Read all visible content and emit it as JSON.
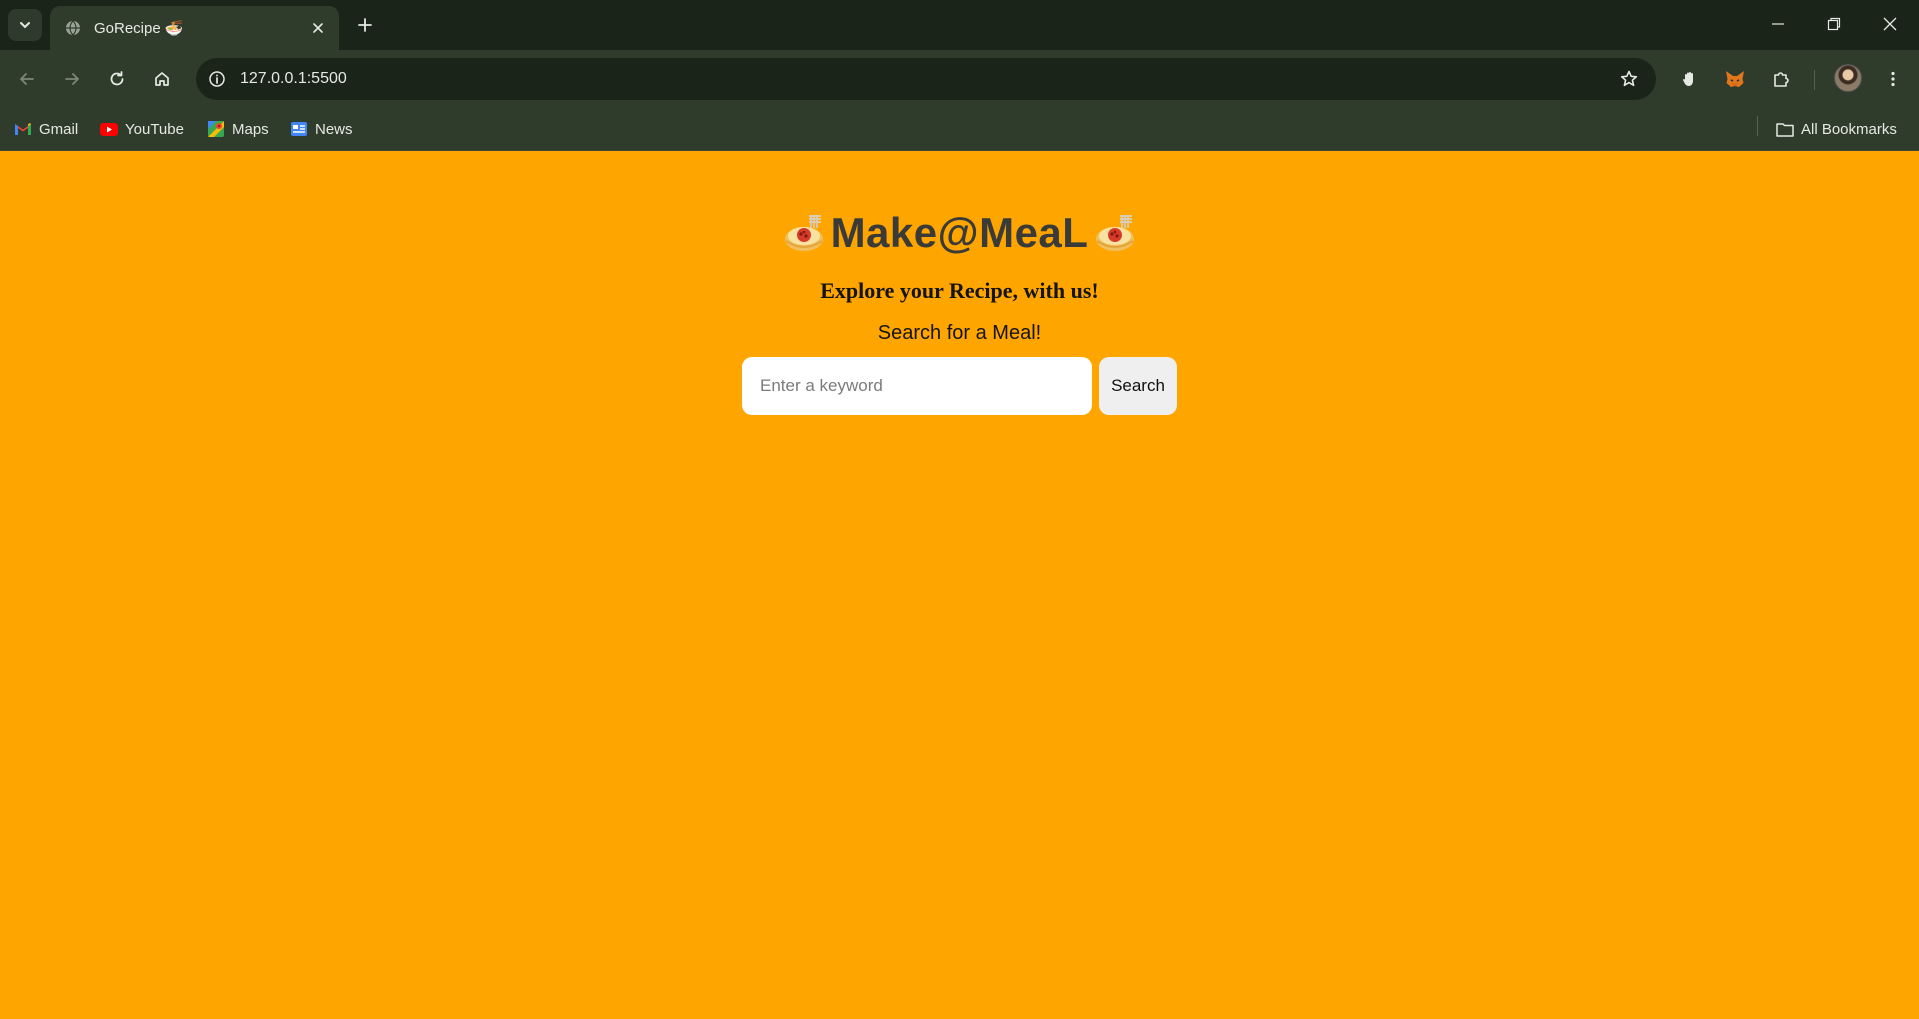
{
  "browser": {
    "tab": {
      "title": "GoRecipe 🍜"
    },
    "address_bar": {
      "url": "127.0.0.1:5500"
    },
    "bookmarks": [
      {
        "label": "Gmail",
        "icon": "gmail-icon"
      },
      {
        "label": "YouTube",
        "icon": "youtube-icon"
      },
      {
        "label": "Maps",
        "icon": "maps-icon"
      },
      {
        "label": "News",
        "icon": "news-icon"
      }
    ],
    "all_bookmarks_label": "All Bookmarks"
  },
  "page": {
    "title": "Make@MeaL",
    "title_icon": "spaghetti-icon",
    "tagline": "Explore your Recipe, with us!",
    "search_label": "Search for a Meal!",
    "search_placeholder": "Enter a keyword",
    "search_value": "",
    "search_button": "Search"
  },
  "colors": {
    "page_background": "#FFA500",
    "chrome_dark": "#1b2419",
    "chrome_mid": "#2f3c2c",
    "title_text": "#3a3b38"
  }
}
